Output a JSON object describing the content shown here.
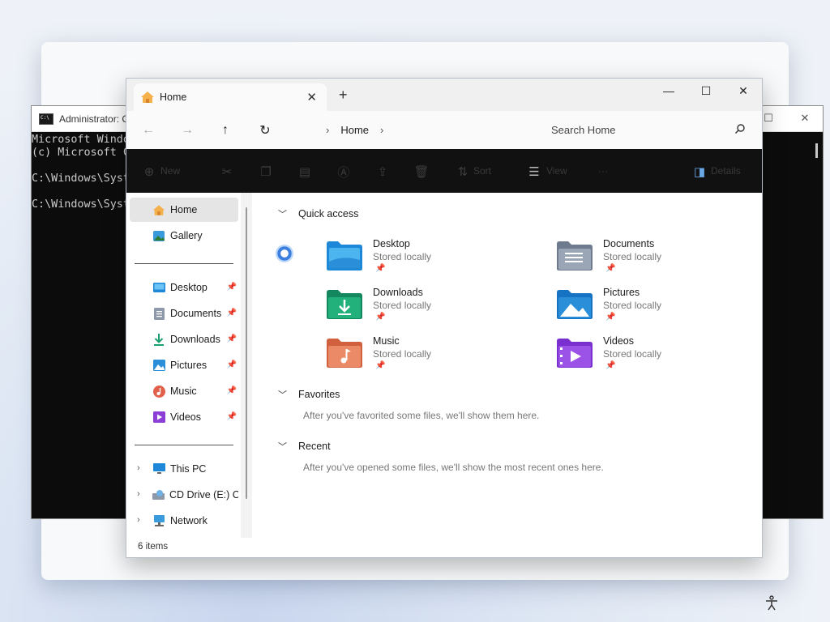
{
  "cmd": {
    "title": "Administrator: C",
    "lines": [
      "Microsoft Windo",
      "(c) Microsoft C",
      "",
      "C:\\Windows\\Syst",
      "",
      "C:\\Windows\\Syst"
    ]
  },
  "explorer": {
    "tab": {
      "label": "Home"
    },
    "window_controls": {
      "minimize": "—",
      "maximize": "☐",
      "close": "✕"
    },
    "address": {
      "crumb": "Home"
    },
    "search": {
      "placeholder": "Search Home"
    },
    "toolbar": {
      "new": "New",
      "sort": "Sort",
      "view": "View",
      "more": "···",
      "details": "Details"
    },
    "sidebar": {
      "top": [
        {
          "label": "Home",
          "icon": "home-icon",
          "selected": true
        },
        {
          "label": "Gallery",
          "icon": "gallery-icon"
        }
      ],
      "pinned": [
        {
          "label": "Desktop",
          "icon": "desktop-icon"
        },
        {
          "label": "Documents",
          "icon": "documents-icon"
        },
        {
          "label": "Downloads",
          "icon": "downloads-icon"
        },
        {
          "label": "Pictures",
          "icon": "pictures-icon"
        },
        {
          "label": "Music",
          "icon": "music-icon"
        },
        {
          "label": "Videos",
          "icon": "videos-icon"
        }
      ],
      "drives": [
        {
          "label": "This PC",
          "icon": "this-pc-icon"
        },
        {
          "label": "CD Drive (E:) CC",
          "icon": "cd-drive-icon"
        },
        {
          "label": "Network",
          "icon": "network-icon"
        }
      ]
    },
    "quick_access": {
      "heading": "Quick access",
      "items": [
        {
          "name": "Desktop",
          "status": "Stored locally",
          "icon": "desktop-folder-icon"
        },
        {
          "name": "Documents",
          "status": "Stored locally",
          "icon": "documents-folder-icon"
        },
        {
          "name": "Downloads",
          "status": "Stored locally",
          "icon": "downloads-folder-icon"
        },
        {
          "name": "Pictures",
          "status": "Stored locally",
          "icon": "pictures-folder-icon"
        },
        {
          "name": "Music",
          "status": "Stored locally",
          "icon": "music-folder-icon"
        },
        {
          "name": "Videos",
          "status": "Stored locally",
          "icon": "videos-folder-icon"
        }
      ]
    },
    "favorites": {
      "heading": "Favorites",
      "empty": "After you've favorited some files, we'll show them here."
    },
    "recent": {
      "heading": "Recent",
      "empty": "After you've opened some files, we'll show the most recent ones here."
    },
    "status": {
      "count": "6 items"
    }
  },
  "colors": {
    "accent": "#0067c0",
    "folder_blue": "#3a9bdc",
    "toolbar_bg": "#111111"
  }
}
